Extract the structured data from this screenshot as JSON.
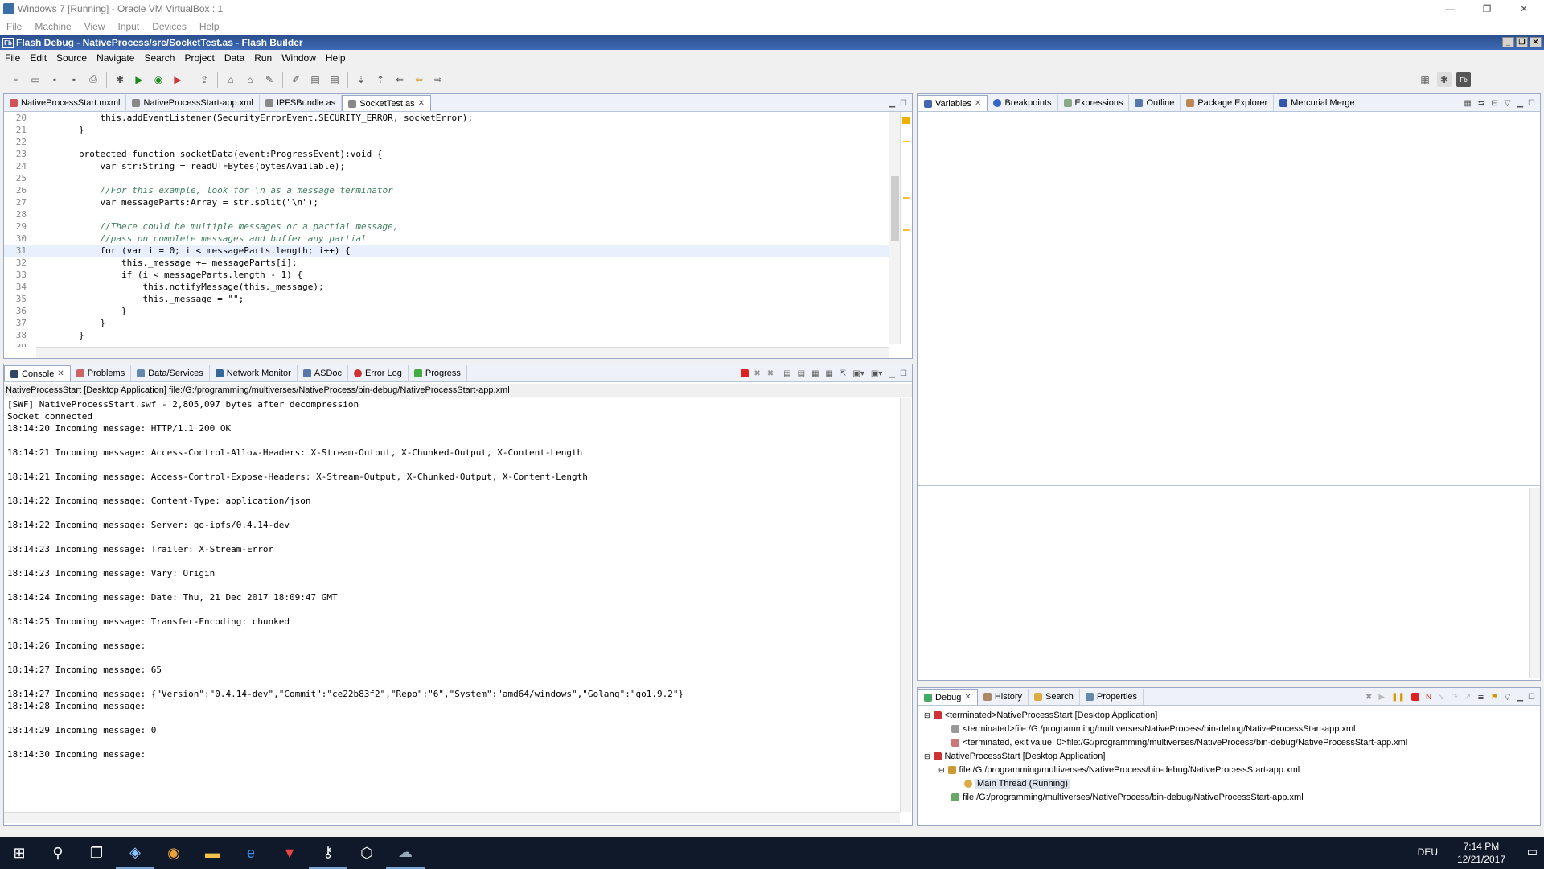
{
  "vbox": {
    "title": "Windows 7 [Running] - Oracle VM VirtualBox : 1",
    "menu": [
      "File",
      "Machine",
      "View",
      "Input",
      "Devices",
      "Help"
    ]
  },
  "fb": {
    "title": "Flash Debug - NativeProcess/src/SocketTest.as - Flash Builder",
    "icon": "Fb",
    "menu": [
      "File",
      "Edit",
      "Source",
      "Navigate",
      "Search",
      "Project",
      "Data",
      "Run",
      "Window",
      "Help"
    ]
  },
  "editor": {
    "tabs": [
      "NativeProcessStart.mxml",
      "NativeProcessStart-app.xml",
      "IPFSBundle.as",
      "SocketTest.as"
    ],
    "active_tab": 3
  },
  "code_lines": [
    {
      "n": "20",
      "t": "            this.addEventListener(SecurityErrorEvent.SECURITY_ERROR, socketError);"
    },
    {
      "n": "21",
      "t": "        }"
    },
    {
      "n": "22",
      "t": ""
    },
    {
      "n": "23",
      "t": "        protected function socketData(event:ProgressEvent):void {"
    },
    {
      "n": "24",
      "t": "            var str:String = readUTFBytes(bytesAvailable);"
    },
    {
      "n": "25",
      "t": ""
    },
    {
      "n": "26",
      "t": "            //For this example, look for \\n as a message terminator"
    },
    {
      "n": "27",
      "t": "            var messageParts:Array = str.split(\"\\n\");"
    },
    {
      "n": "28",
      "t": ""
    },
    {
      "n": "29",
      "t": "            //There could be multiple messages or a partial message,"
    },
    {
      "n": "30",
      "t": "            //pass on complete messages and buffer any partial"
    },
    {
      "n": "31",
      "t": "            for (var i = 0; i < messageParts.length; i++) {"
    },
    {
      "n": "32",
      "t": "                this._message += messageParts[i];"
    },
    {
      "n": "33",
      "t": "                if (i < messageParts.length - 1) {"
    },
    {
      "n": "34",
      "t": "                    this.notifyMessage(this._message);"
    },
    {
      "n": "35",
      "t": "                    this._message = \"\";"
    },
    {
      "n": "36",
      "t": "                }"
    },
    {
      "n": "37",
      "t": "            }"
    },
    {
      "n": "38",
      "t": "        }"
    },
    {
      "n": "39",
      "t": ""
    }
  ],
  "console": {
    "tabs": [
      "Console",
      "Problems",
      "Data/Services",
      "Network Monitor",
      "ASDoc",
      "Error Log",
      "Progress"
    ],
    "path": "NativeProcessStart [Desktop Application] file:/G:/programming/multiverses/NativeProcess/bin-debug/NativeProcessStart-app.xml",
    "lines": [
      "[SWF] NativeProcessStart.swf - 2,805,097 bytes after decompression",
      "Socket connected",
      "18:14:20 Incoming message: HTTP/1.1 200 OK",
      "",
      "18:14:21 Incoming message: Access-Control-Allow-Headers: X-Stream-Output, X-Chunked-Output, X-Content-Length",
      "",
      "18:14:21 Incoming message: Access-Control-Expose-Headers: X-Stream-Output, X-Chunked-Output, X-Content-Length",
      "",
      "18:14:22 Incoming message: Content-Type: application/json",
      "",
      "18:14:22 Incoming message: Server: go-ipfs/0.4.14-dev",
      "",
      "18:14:23 Incoming message: Trailer: X-Stream-Error",
      "",
      "18:14:23 Incoming message: Vary: Origin",
      "",
      "18:14:24 Incoming message: Date: Thu, 21 Dec 2017 18:09:47 GMT",
      "",
      "18:14:25 Incoming message: Transfer-Encoding: chunked",
      "",
      "18:14:26 Incoming message:",
      "",
      "18:14:27 Incoming message: 65",
      "",
      "18:14:27 Incoming message: {\"Version\":\"0.4.14-dev\",\"Commit\":\"ce22b83f2\",\"Repo\":\"6\",\"System\":\"amd64/windows\",\"Golang\":\"go1.9.2\"}",
      "18:14:28 Incoming message:",
      "",
      "18:14:29 Incoming message: 0",
      "",
      "18:14:30 Incoming message:"
    ]
  },
  "right_tabs": [
    "Variables",
    "Breakpoints",
    "Expressions",
    "Outline",
    "Package Explorer",
    "Mercurial Merge"
  ],
  "debug": {
    "tabs": [
      "Debug",
      "History",
      "Search",
      "Properties"
    ],
    "tree": [
      "<terminated>NativeProcessStart [Desktop Application]",
      "<terminated>file:/G:/programming/multiverses/NativeProcess/bin-debug/NativeProcessStart-app.xml",
      "<terminated, exit value: 0>file:/G:/programming/multiverses/NativeProcess/bin-debug/NativeProcessStart-app.xml",
      "NativeProcessStart [Desktop Application]",
      "file:/G:/programming/multiverses/NativeProcess/bin-debug/NativeProcessStart-app.xml",
      "Main Thread (Running)",
      "file:/G:/programming/multiverses/NativeProcess/bin-debug/NativeProcessStart-app.xml"
    ]
  },
  "taskbar": {
    "lang": "DEU",
    "time": "7:14 PM",
    "date": "12/21/2017",
    "apps": [
      "start-icon",
      "search-icon",
      "task-view-icon",
      "virtualbox-icon",
      "chrome-icon",
      "explorer-icon",
      "edge-icon",
      "vivaldi-icon",
      "keepass-icon",
      "box-icon",
      "steam-icon"
    ]
  }
}
